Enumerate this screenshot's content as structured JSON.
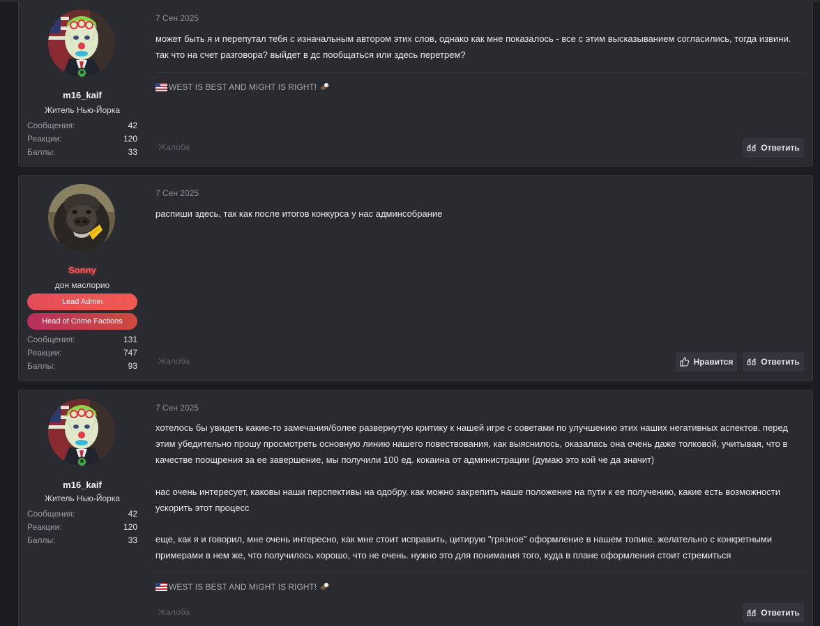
{
  "posts": [
    {
      "date": "7 Сен 2025",
      "username": "m16_kaif",
      "user_title": "Житель Нью-Йорка",
      "avatar_icon": "president-clown-avatar",
      "banners": [],
      "stats": [
        {
          "label": "Сообщения:",
          "value": "42"
        },
        {
          "label": "Реакции:",
          "value": "120"
        },
        {
          "label": "Баллы:",
          "value": "33"
        }
      ],
      "paragraphs": [
        "может быть я и перепутал тебя с изначальным автором этих слов, однако как мне показалось - все с этим высказыванием согласились, тогда извини. так что на счет разговора? выйдет в дс пообщаться или здесь перетрем?"
      ],
      "signature": "WEST IS BEST AND MIGHT IS RIGHT!",
      "report_label": "Жалоба",
      "reply_label": "Ответить"
    },
    {
      "date": "7 Сен 2025",
      "username": "Sonny",
      "user_title": "дон маслорио",
      "avatar_icon": "gorilla-avatar",
      "banners": [
        {
          "label": "Lead Admin",
          "color": "#e94b56"
        },
        {
          "label": "Head of Crime Factions",
          "color": "#c0335a"
        }
      ],
      "stats": [
        {
          "label": "Сообщения:",
          "value": "131"
        },
        {
          "label": "Реакции:",
          "value": "747"
        },
        {
          "label": "Баллы:",
          "value": "93"
        }
      ],
      "paragraphs": [
        "распиши здесь, так как после итогов конкурса у нас админсобрание"
      ],
      "report_label": "Жалоба",
      "like_label": "Нравится",
      "reply_label": "Ответить"
    },
    {
      "date": "7 Сен 2025",
      "username": "m16_kaif",
      "user_title": "Житель Нью-Йорка",
      "avatar_icon": "president-clown-avatar",
      "banners": [],
      "stats": [
        {
          "label": "Сообщения:",
          "value": "42"
        },
        {
          "label": "Реакции:",
          "value": "120"
        },
        {
          "label": "Баллы:",
          "value": "33"
        }
      ],
      "paragraphs": [
        "хотелось бы увидеть какие-то замечания/более развернутую критику к нашей игре с советами по улучшению этих наших негативных аспектов. перед этим убедительно прошу просмотреть основную линию нашего повествования, как выяснилось, оказалась она очень даже толковой, учитывая, что в качестве поощрения за ее завершение, мы получили 100 ед. кокаина от администрации (думаю это кой че да значит)",
        "нас очень интересует, каковы наши перспективы на одобру. как можно закрепить наше положение на пути к ее получению, какие есть возможности ускорить этот процесс",
        "еще, как я и говорил, мне очень интересно, как мне стоит исправить, цитирую \"грязное\" оформление в нашем топике. желательно с конкретными примерами в нем же, что получилось хорошо, что не очень. нужно это для понимания того, куда в плане оформления стоит стремиться"
      ],
      "signature": "WEST IS BEST AND MIGHT IS RIGHT!",
      "report_label": "Жалоба",
      "reply_label": "Ответить"
    }
  ]
}
